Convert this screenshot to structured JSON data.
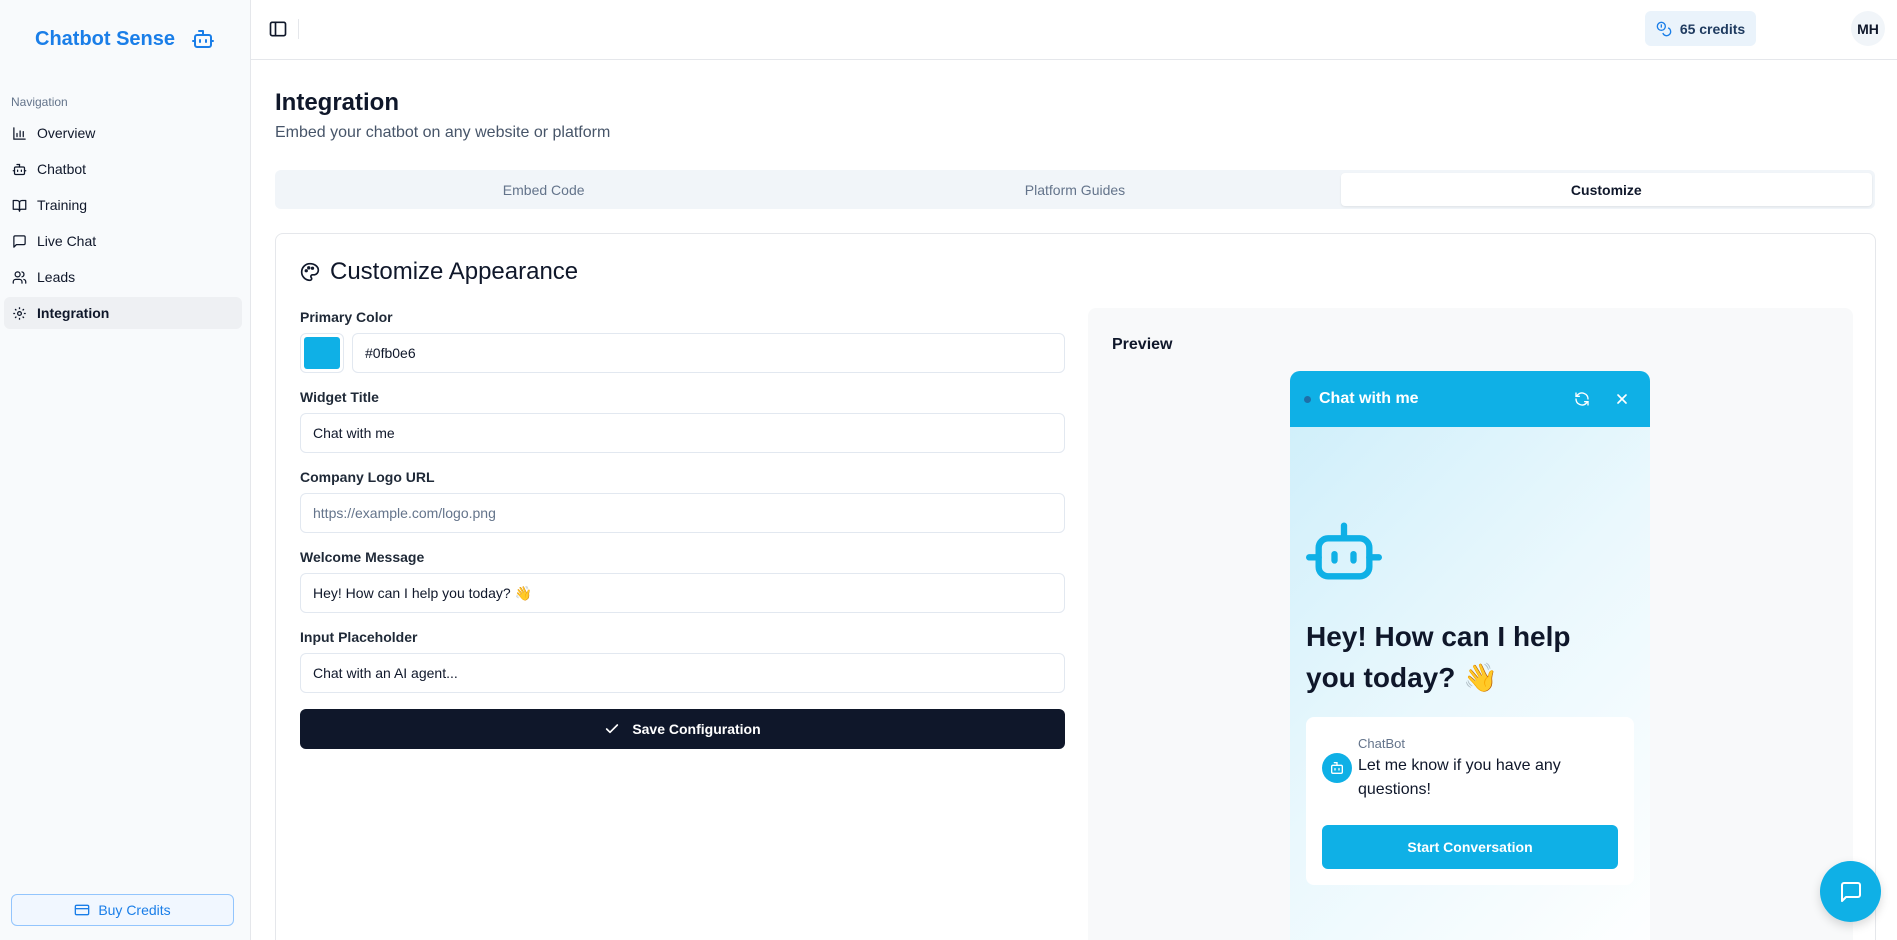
{
  "brand": {
    "name": "Chatbot Sense",
    "color": "#1a7ee8"
  },
  "sidebar": {
    "heading": "Navigation",
    "items": [
      {
        "label": "Overview",
        "icon": "bar-chart-icon"
      },
      {
        "label": "Chatbot",
        "icon": "bot-icon"
      },
      {
        "label": "Training",
        "icon": "book-icon"
      },
      {
        "label": "Live Chat",
        "icon": "message-square-icon"
      },
      {
        "label": "Leads",
        "icon": "users-icon"
      },
      {
        "label": "Integration",
        "icon": "gear-icon",
        "active": true
      }
    ],
    "buy_credits": "Buy Credits"
  },
  "topbar": {
    "credits": "65 credits",
    "avatar": "MH"
  },
  "page": {
    "title": "Integration",
    "subtitle": "Embed your chatbot on any website or platform",
    "tabs": [
      {
        "label": "Embed Code"
      },
      {
        "label": "Platform Guides"
      },
      {
        "label": "Customize",
        "active": true
      }
    ]
  },
  "customize": {
    "title": "Customize Appearance",
    "primary_color_label": "Primary Color",
    "primary_color": "#0fb0e6",
    "widget_title_label": "Widget Title",
    "widget_title": "Chat with me",
    "logo_url_label": "Company Logo URL",
    "logo_url_placeholder": "https://example.com/logo.png",
    "welcome_label": "Welcome Message",
    "welcome_message": "Hey! How can I help you today? 👋",
    "input_placeholder_label": "Input Placeholder",
    "input_placeholder": "Chat with an AI agent...",
    "save_label": "Save Configuration"
  },
  "preview": {
    "label": "Preview",
    "header_title": "Chat with me",
    "welcome": "Hey! How can I help you today? 👋",
    "sender": "ChatBot",
    "message": "Let me know if you have any questions!",
    "start_button": "Start Conversation"
  }
}
